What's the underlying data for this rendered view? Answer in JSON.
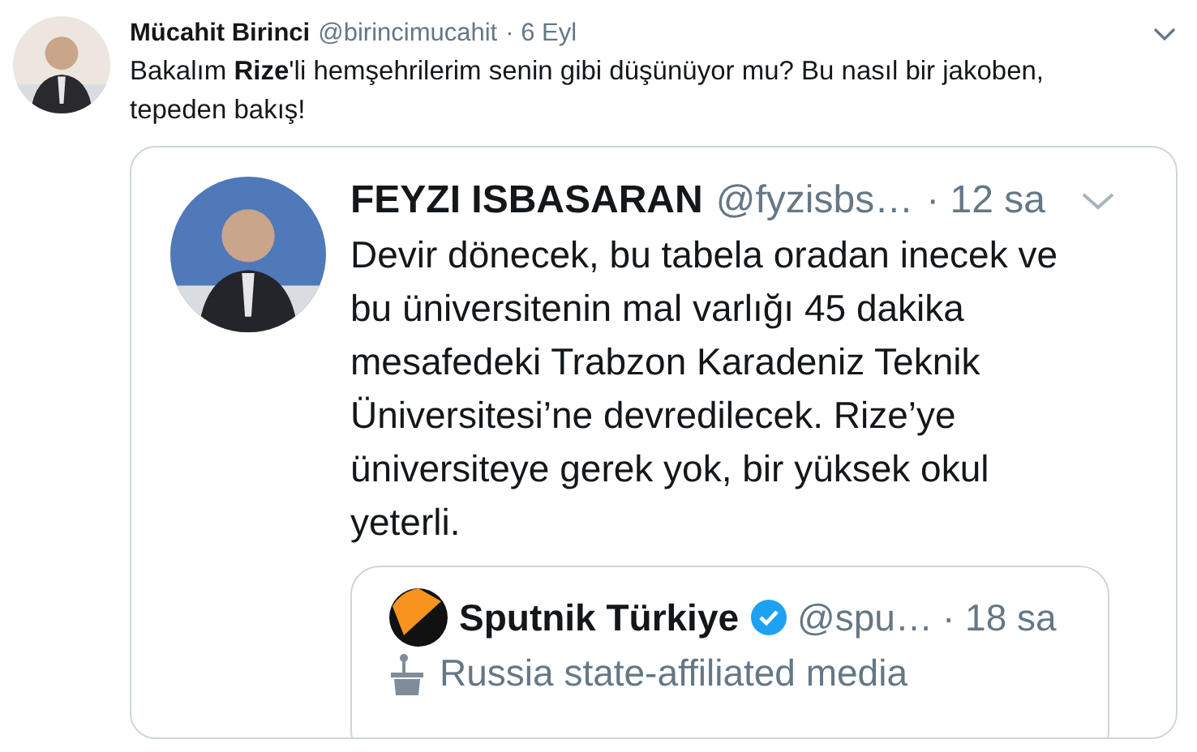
{
  "tweet": {
    "author": "Mücahit Birinci",
    "handle": "@birincimucahit",
    "time": "· 6 Eyl",
    "text": "Bakalım **Rize**'li hemşehrilerim senin gibi düşünüyor mu? Bu nasıl bir jakoben, tepeden bakış!",
    "screenshot": {
      "author": "FEYZI ISBASARAN",
      "handle": "@fyzisbs…",
      "time": "· 12 sa",
      "text": "Devir dönecek, bu tabela oradan inecek ve bu üniversitenin mal varlığı 45 dakika mesafedeki Trabzon Karadeniz Teknik Üniversitesi’ne devredilecek. Rize’ye üniversiteye gerek yok, bir yüksek okul yeterli.",
      "quoted": {
        "author": "Sputnik Türkiye",
        "verified": true,
        "handle": "@spu…",
        "time": "· 18 sa",
        "label": "Russia state-affiliated media"
      }
    }
  }
}
